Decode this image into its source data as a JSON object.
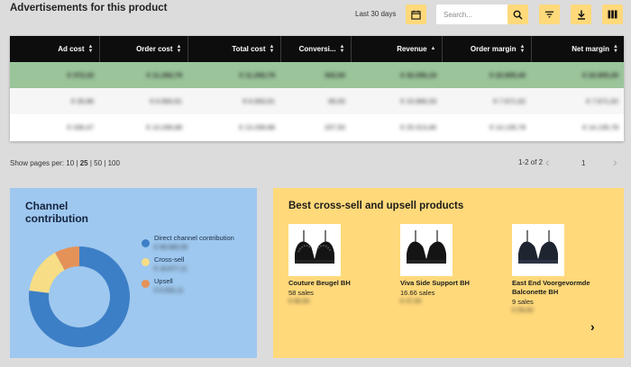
{
  "header": {
    "title": "Advertisements for this product",
    "period_label": "Last 30 days",
    "search_placeholder": "Search..."
  },
  "table": {
    "columns": [
      {
        "label": "Ad cost",
        "sort": "both"
      },
      {
        "label": "Order cost",
        "sort": "both"
      },
      {
        "label": "Total cost",
        "sort": "both"
      },
      {
        "label": "Conversi...",
        "sort": "both"
      },
      {
        "label": "Revenue",
        "sort": "asc"
      },
      {
        "label": "Order margin",
        "sort": "both"
      },
      {
        "label": "Net margin",
        "sort": "both"
      }
    ],
    "rows": [
      [
        "€ 372,32",
        "€ 11.292,79",
        "€ 11.292,79",
        "302,50",
        "€ 42.256,19",
        "€ 22.805,40",
        "€ 22.805,40"
      ],
      [
        "€ 35,86",
        "€ 6.993,91",
        "€ 6.993,91",
        "95,00",
        "€ 15.966,33",
        "€ 7.671,62",
        "€ 7.671,62"
      ],
      [
        "€ 336,47",
        "€ 13.299,88",
        "€ 13.299,88",
        "207,50",
        "€ 25.313,46",
        "€ 14.135,78",
        "€ 14.135,78"
      ]
    ]
  },
  "pagination": {
    "label": "Show pages per:",
    "options": [
      "10",
      "25",
      "50",
      "100"
    ],
    "selected": "25",
    "range": "1-2 of 2",
    "current_page": "1",
    "prev_icon": "chevron-left-icon",
    "next_icon": "chevron-right-icon"
  },
  "channel": {
    "title": "Channel contribution",
    "items": [
      {
        "label": "Direct channel contribution",
        "value": "€ 99.560,56",
        "color": "#3d7fc6",
        "share": 0.77
      },
      {
        "label": "Cross-sell",
        "value": "€ 18.877,11",
        "color": "#f7dd85",
        "share": 0.15
      },
      {
        "label": "Upsell",
        "value": "€ 6.932,11",
        "color": "#e49258",
        "share": 0.08
      }
    ]
  },
  "cross_sell": {
    "title": "Best cross-sell and upsell products",
    "products": [
      {
        "name": "Couture Beugel BH",
        "sales": "58 sales",
        "price": "€ 66,50"
      },
      {
        "name": "Viva Side Support BH",
        "sales": "16.66 sales",
        "price": "€ 37,00"
      },
      {
        "name": "East End Voorgevormde Balconette BH",
        "sales": "9 sales",
        "price": "€ 59,00"
      }
    ],
    "next_icon": "chevron-right-icon"
  },
  "colors": {
    "accent_yellow": "#ffd97a",
    "total_row_green": "#9bc49a",
    "channel_card_blue": "#9ec8ef",
    "header_black": "#0d0d0d"
  }
}
